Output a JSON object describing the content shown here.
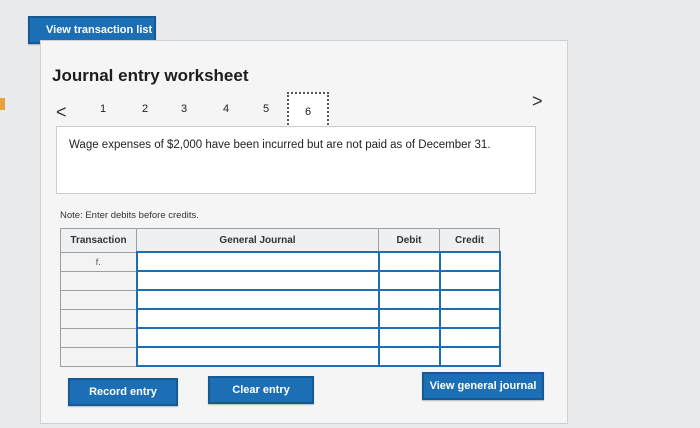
{
  "header": {
    "view_transaction_list": "View transaction list"
  },
  "worksheet": {
    "title": "Journal entry worksheet",
    "prev_arrow": "<",
    "next_arrow": ">",
    "steps": [
      "1",
      "2",
      "3",
      "4",
      "5",
      "6"
    ],
    "active_step": "6",
    "description": "Wage expenses of $2,000 have been incurred but are not paid as of December 31.",
    "note": "Note: Enter debits before credits."
  },
  "journal_table": {
    "columns": [
      "Transaction",
      "General Journal",
      "Debit",
      "Credit"
    ],
    "rows": [
      {
        "transaction": "f.",
        "account": "",
        "debit": "",
        "credit": ""
      },
      {
        "transaction": "",
        "account": "",
        "debit": "",
        "credit": ""
      },
      {
        "transaction": "",
        "account": "",
        "debit": "",
        "credit": ""
      },
      {
        "transaction": "",
        "account": "",
        "debit": "",
        "credit": ""
      },
      {
        "transaction": "",
        "account": "",
        "debit": "",
        "credit": ""
      },
      {
        "transaction": "",
        "account": "",
        "debit": "",
        "credit": ""
      }
    ]
  },
  "buttons": {
    "record_entry": "Record entry",
    "clear_entry": "Clear entry",
    "view_general_journal": "View general journal"
  },
  "colors": {
    "accent": "#1c6fb5",
    "panel": "#f5f5f6",
    "background": "#e9eaec"
  }
}
